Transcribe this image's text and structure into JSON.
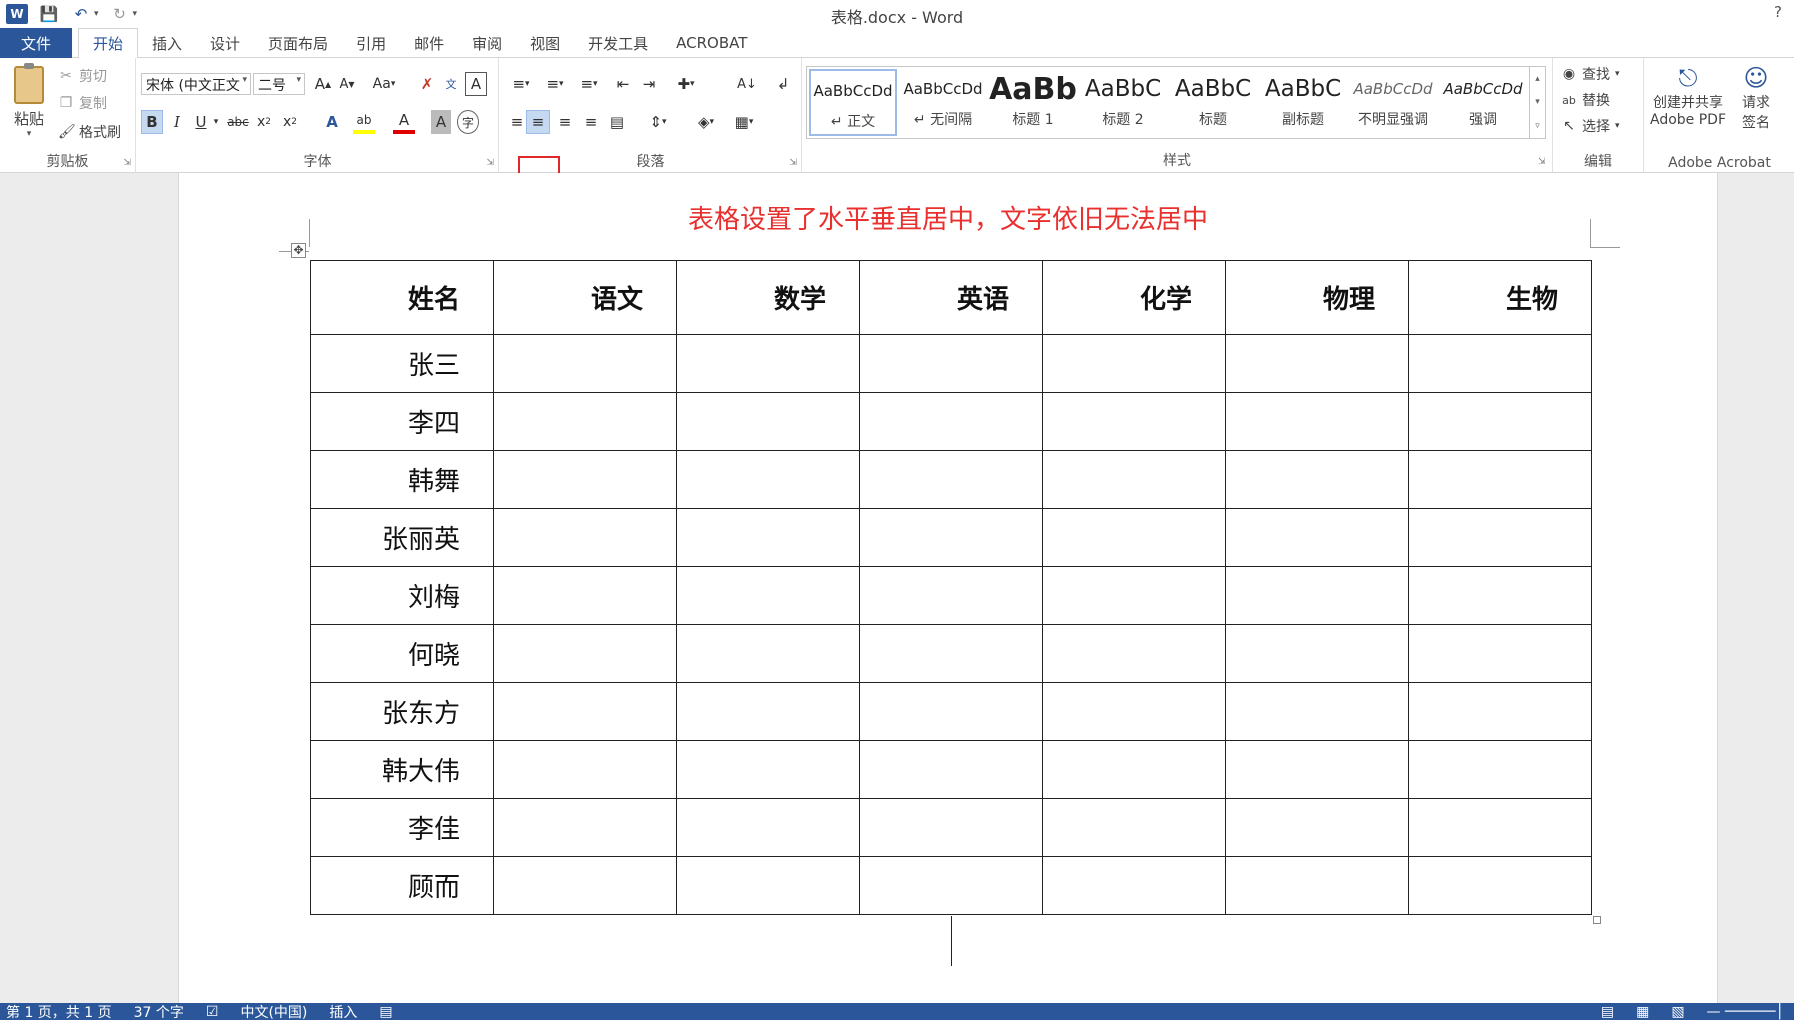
{
  "app": {
    "window_title": "表格.docx - Word",
    "help": "?"
  },
  "quick_access": {
    "logo": "W",
    "icons": [
      "save-icon",
      "undo-icon",
      "redo-icon",
      "customize-icon"
    ]
  },
  "tabs": {
    "file": "文件",
    "items": [
      "开始",
      "插入",
      "设计",
      "页面布局",
      "引用",
      "邮件",
      "审阅",
      "视图",
      "开发工具",
      "ACROBAT"
    ],
    "active": "开始"
  },
  "clipboard": {
    "paste": "粘贴",
    "cut": "剪切",
    "copy": "复制",
    "format_painter": "格式刷",
    "label": "剪贴板"
  },
  "font": {
    "name": "宋体 (中文正文",
    "size": "二号",
    "label": "字体"
  },
  "paragraph": {
    "label": "段落"
  },
  "styles": {
    "label": "样式",
    "items": [
      {
        "preview": "AaBbCcDd",
        "name": "正文",
        "mark": "↵"
      },
      {
        "preview": "AaBbCcDd",
        "name": "无间隔",
        "mark": "↵"
      },
      {
        "preview": "AaBb",
        "name": "标题 1",
        "mark": ""
      },
      {
        "preview": "AaBbC",
        "name": "标题 2",
        "mark": ""
      },
      {
        "preview": "AaBbC",
        "name": "标题",
        "mark": ""
      },
      {
        "preview": "AaBbC",
        "name": "副标题",
        "mark": ""
      },
      {
        "preview": "AaBbCcDd",
        "name": "不明显强调",
        "mark": ""
      },
      {
        "preview": "AaBbCcDd",
        "name": "强调",
        "mark": ""
      }
    ]
  },
  "editing": {
    "find": "查找",
    "replace": "替换",
    "select": "选择",
    "label": "编辑"
  },
  "acrobat": {
    "create_share": "创建并共享",
    "create_share_line2": "Adobe PDF",
    "request_sign": "请求",
    "request_sign_line2": "签名",
    "label": "Adobe Acrobat"
  },
  "document": {
    "note": "表格设置了水平垂直居中，文字依旧无法居中",
    "table": {
      "header": [
        "姓名",
        "语文",
        "数学",
        "英语",
        "化学",
        "物理",
        "生物"
      ],
      "names": [
        "张三",
        "李四",
        "韩舞",
        "张丽英",
        "刘梅",
        "何晓",
        "张东方",
        "韩大伟",
        "李佳",
        "顾而"
      ]
    }
  },
  "statusbar": {
    "page": "第 1 页，共 1 页",
    "words": "37 个字",
    "language": "中文(中国)",
    "mode": "插入"
  },
  "colors": {
    "accent": "#2b579a",
    "highlight_box": "#e0282a",
    "note_text": "#e8302e"
  }
}
